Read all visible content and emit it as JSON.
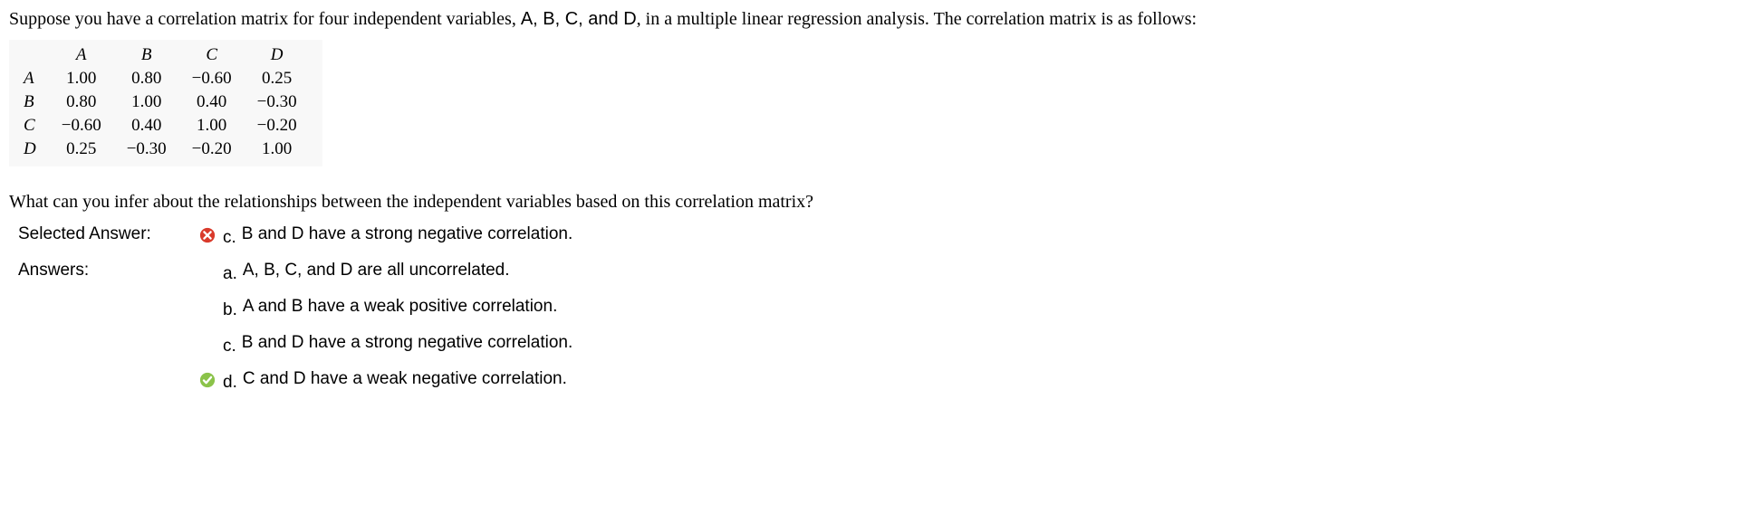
{
  "question": {
    "intro": "Suppose you have a correlation matrix for four independent variables, ",
    "vars": "A, B, C, and D",
    "mid": ", in a multiple linear regression analysis. The correlation matrix is as follows:",
    "sub": "What can you infer about the relationships between the independent variables based on this correlation matrix?"
  },
  "matrix": {
    "headers": [
      "",
      "A",
      "B",
      "C",
      "D"
    ],
    "rows": [
      [
        "A",
        "1.00",
        "0.80",
        "−0.60",
        "0.25"
      ],
      [
        "B",
        "0.80",
        "1.00",
        "0.40",
        "−0.30"
      ],
      [
        "C",
        "−0.60",
        "0.40",
        "1.00",
        "−0.20"
      ],
      [
        "D",
        "0.25",
        "−0.30",
        "−0.20",
        "1.00"
      ]
    ]
  },
  "labels": {
    "selected": "Selected Answer:",
    "answers": "Answers:"
  },
  "selected": {
    "status": "incorrect",
    "letter": "c.",
    "text": "B and D have a strong negative correlation."
  },
  "answers": [
    {
      "letter": "a.",
      "text": "A, B, C, and D are all uncorrelated.",
      "status": "none"
    },
    {
      "letter": "b.",
      "text": "A and B have a weak positive correlation.",
      "status": "none"
    },
    {
      "letter": "c.",
      "text": "B and D have a strong negative correlation.",
      "status": "none"
    },
    {
      "letter": "d.",
      "text": "C and D have a weak negative correlation.",
      "status": "correct"
    }
  ]
}
